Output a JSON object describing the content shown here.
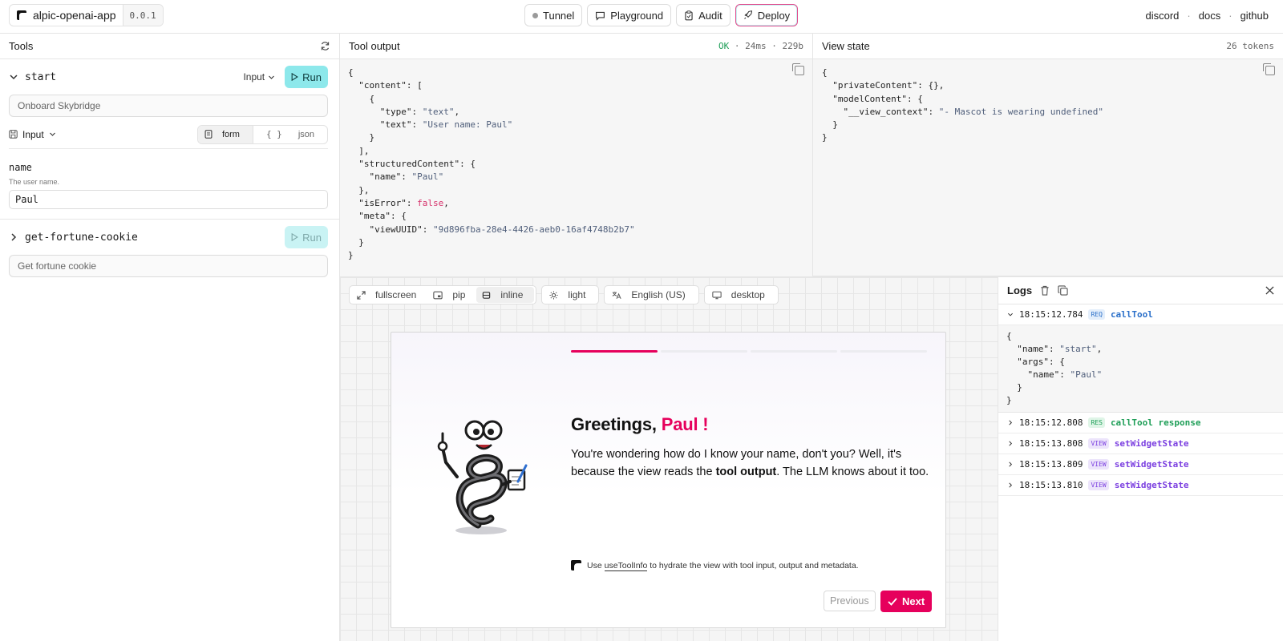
{
  "app": {
    "name": "alpic-openai-app",
    "version": "0.0.1"
  },
  "nav": {
    "tunnel": "Tunnel",
    "playground": "Playground",
    "audit": "Audit",
    "deploy": "Deploy"
  },
  "links": {
    "discord": "discord",
    "docs": "docs",
    "github": "github",
    "sep": "·"
  },
  "tools": {
    "title": "Tools",
    "items": [
      {
        "name": "start",
        "input_label": "Input",
        "run": "Run",
        "description": "Onboard Skybridge",
        "expanded": true
      },
      {
        "name": "get-fortune-cookie",
        "run": "Run",
        "description": "Get fortune cookie",
        "expanded": false
      }
    ],
    "input_section": {
      "label": "Input",
      "form": "form",
      "json": "json"
    },
    "field": {
      "name": "name",
      "help": "The user name.",
      "value": "Paul"
    }
  },
  "output": {
    "title": "Tool output",
    "status": "OK",
    "timing": "24ms",
    "size": "229b",
    "sep": "·",
    "content_type": "\"text\"",
    "content_text": "\"User name: Paul\"",
    "name": "\"Paul\"",
    "isError": "false",
    "viewUUID": "\"9d896fba-28e4-4426-aeb0-16af4748b2b7\""
  },
  "viewstate": {
    "title": "View state",
    "tokens": "26 tokens",
    "view_context": "\"- Mascot is wearing undefined\""
  },
  "preview": {
    "toolbar": {
      "fullscreen": "fullscreen",
      "pip": "pip",
      "inline": "inline",
      "theme": "light",
      "locale": "English (US)",
      "device": "desktop"
    },
    "greeting": "Greetings,",
    "user_name": "Paul !",
    "blurb_start": "You're wondering how do I know your name, don't you? Well, it's because the view reads the",
    "blurb_bold": "tool output",
    "blurb_end": ". The LLM knows about it too.",
    "hint_use": "Use",
    "hint_link": "useToolInfo",
    "hint_rest": "to hydrate the view with tool input, output and metadata.",
    "previous": "Previous",
    "next": "Next",
    "progress_step": 1,
    "progress_total": 4,
    "accent": "#e6005c"
  },
  "logs": {
    "title": "Logs",
    "expanded_args_name": "\"start\"",
    "expanded_args_value": "\"Paul\"",
    "entries": [
      {
        "time": "18:15:12.784",
        "tag": "REQ",
        "method": "callTool"
      },
      {
        "time": "18:15:12.808",
        "tag": "RES",
        "method": "callTool response"
      },
      {
        "time": "18:15:13.808",
        "tag": "VIEW",
        "method": "setWidgetState"
      },
      {
        "time": "18:15:13.809",
        "tag": "VIEW",
        "method": "setWidgetState"
      },
      {
        "time": "18:15:13.810",
        "tag": "VIEW",
        "method": "setWidgetState"
      }
    ]
  }
}
